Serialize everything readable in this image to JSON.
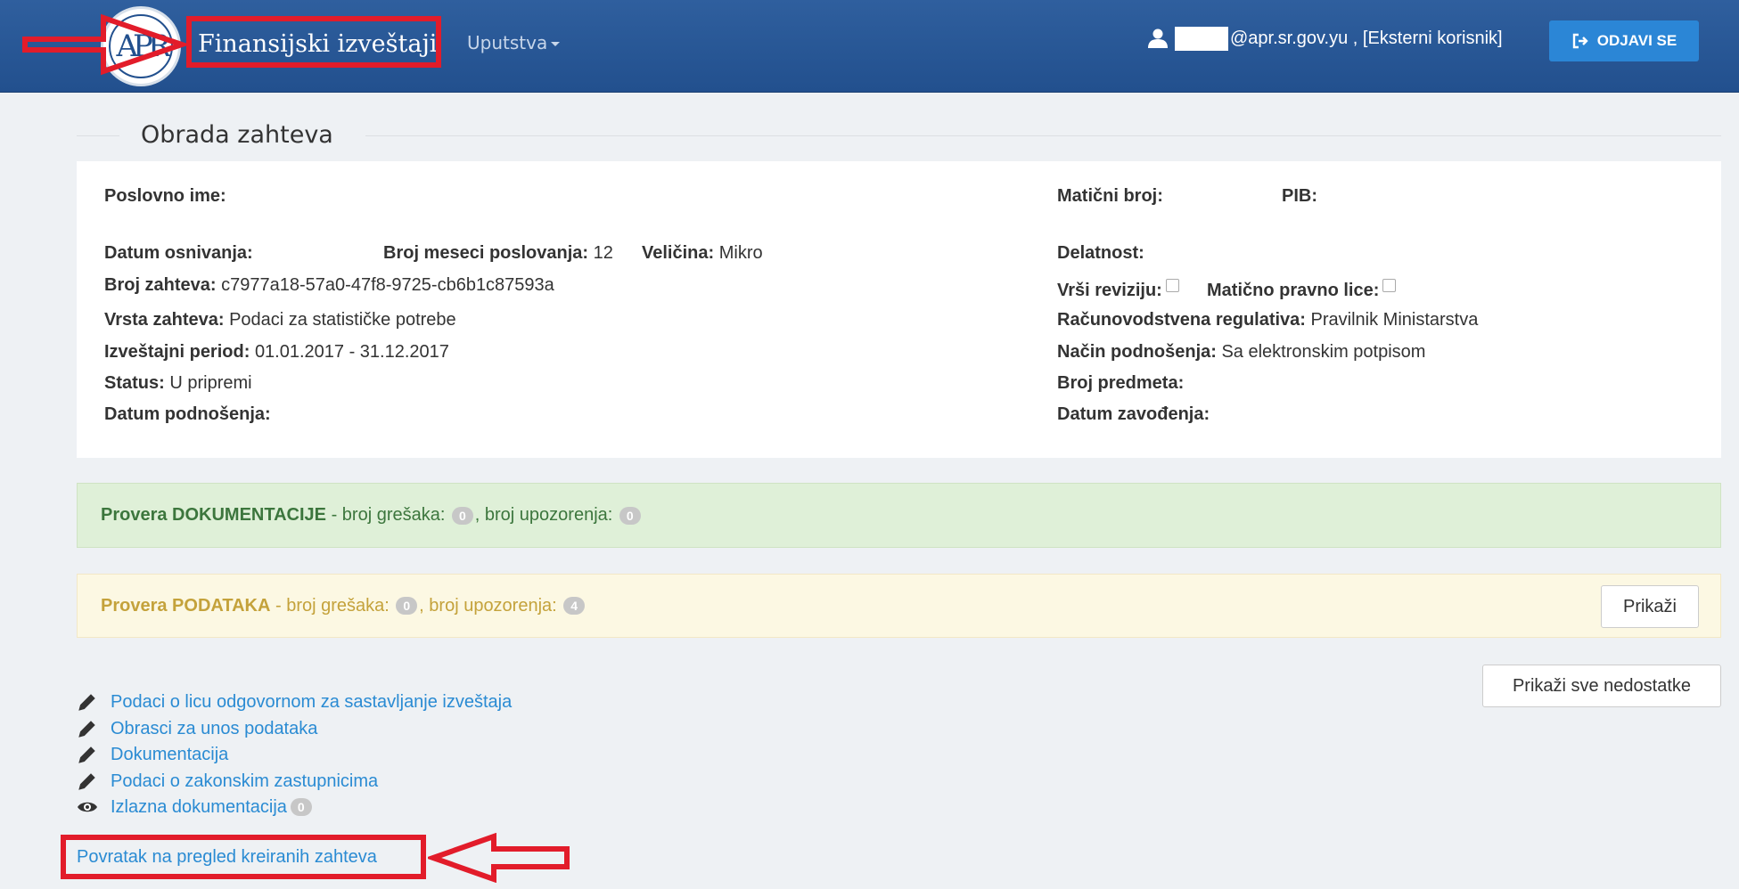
{
  "header": {
    "brand": "Finansijski izveštaji",
    "menu_label": "Uputstva",
    "user_text": "@apr.sr.gov.yu , [Eksterni korisnik]",
    "logout_label": "ODJAVI SE",
    "logo_text": "APR"
  },
  "page": {
    "title": "Obrada zahteva"
  },
  "info": {
    "poslovno_ime_label": "Poslovno ime:",
    "maticni_broj_label": "Matični broj:",
    "pib_label": "PIB:",
    "datum_osnivanja_label": "Datum osnivanja:",
    "broj_meseci_label": "Broj meseci poslovanja:",
    "broj_meseci_value": "12",
    "velicina_label": "Veličina:",
    "velicina_value": "Mikro",
    "delatnost_label": "Delatnost:",
    "broj_zahteva_label": "Broj zahteva:",
    "broj_zahteva_value": "c7977a18-57a0-47f8-9725-cb6b1c87593a",
    "vrsi_reviziju_label": "Vrši reviziju:",
    "maticno_pravno_label": "Matično pravno lice:",
    "vrsta_zahteva_label": "Vrsta zahteva:",
    "vrsta_zahteva_value": "Podaci za statističke potrebe",
    "racunovodstvena_label": "Računovodstvena regulativa:",
    "racunovodstvena_value": "Pravilnik Ministarstva",
    "izvestajni_period_label": "Izveštajni period:",
    "izvestajni_period_value": "01.01.2017 - 31.12.2017",
    "nacin_podnosenja_label": "Način podnošenja:",
    "nacin_podnosenja_value": "Sa elektronskim potpisom",
    "status_label": "Status:",
    "status_value": "U pripremi",
    "broj_predmeta_label": "Broj predmeta:",
    "datum_podnosenja_label": "Datum podnošenja:",
    "datum_zavodjenja_label": "Datum zavođenja:"
  },
  "checks": {
    "doc_strong": "Provera DOKUMENTACIJE",
    "doc_errors_label": " - broj grešaka: ",
    "doc_errors": "0",
    "doc_warnings_label": ", broj upozorenja: ",
    "doc_warnings": "0",
    "data_strong": "Provera PODATAKA",
    "data_errors_label": " - broj grešaka: ",
    "data_errors": "0",
    "data_warnings_label": ", broj upozorenja: ",
    "data_warnings": "4",
    "show_label": "Prikaži",
    "show_all_label": "Prikaži sve nedostatke"
  },
  "links": {
    "items": [
      {
        "label": "Podaci o licu odgovornom za sastavljanje izveštaja",
        "icon": "pencil-icon"
      },
      {
        "label": "Obrasci za unos podataka",
        "icon": "pencil-icon"
      },
      {
        "label": "Dokumentacija",
        "icon": "pencil-icon"
      },
      {
        "label": "Podaci o zakonskim zastupnicima",
        "icon": "pencil-icon"
      },
      {
        "label": "Izlazna dokumentacija",
        "icon": "eye-icon",
        "badge": "0"
      }
    ],
    "back_label": "Povratak na pregled kreiranih zahteva"
  },
  "colors": {
    "navbar": "#22508e",
    "logout_button": "#2b86d6",
    "annotation": "#e21c2a",
    "link": "#2a8bd3",
    "success_bg": "#dff0d8",
    "warning_bg": "#fcf8e3"
  }
}
